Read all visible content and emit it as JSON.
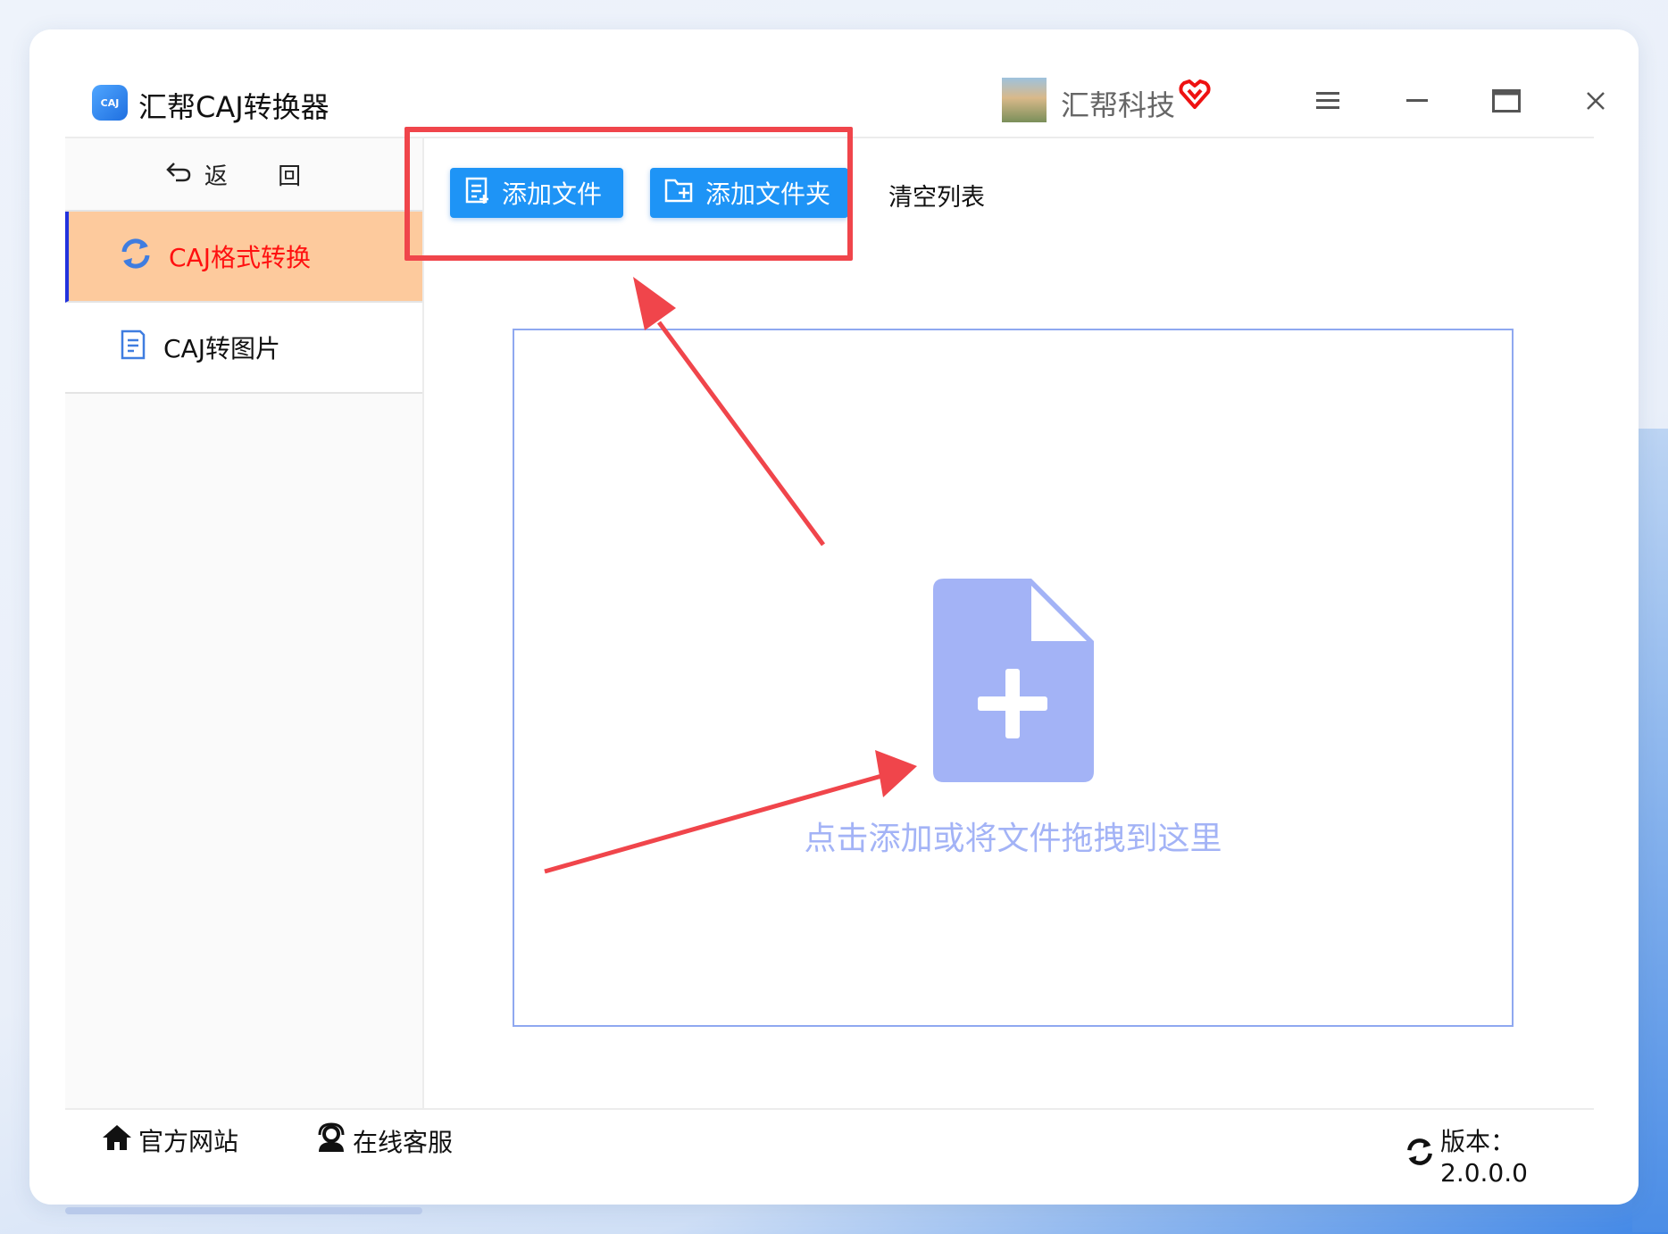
{
  "window": {
    "app_title": "汇帮CAJ转换器",
    "logo_text": "CAJ",
    "user_name": "汇帮科技",
    "icons": [
      "menu-icon",
      "minimize-icon",
      "maximize-icon",
      "close-icon"
    ]
  },
  "sidebar": {
    "back_label": "返 回",
    "items": [
      {
        "label": "CAJ格式转换",
        "icon": "refresh-icon",
        "active": true
      },
      {
        "label": "CAJ转图片",
        "icon": "document-icon",
        "active": false
      }
    ]
  },
  "toolbar": {
    "add_file": "添加文件",
    "add_folder": "添加文件夹",
    "clear_list": "清空列表"
  },
  "dropzone": {
    "hint": "点击添加或将文件拖拽到这里"
  },
  "statusbar": {
    "website": "官方网站",
    "service": "在线客服",
    "version": "版本：2.0.0.0"
  },
  "colors": {
    "accent": "#1e94f6",
    "active_nav_bg": "#fdca9d",
    "active_nav_text": "#ff1010",
    "annotation": "#f0454b",
    "drop_icon": "#a3b3f6"
  }
}
